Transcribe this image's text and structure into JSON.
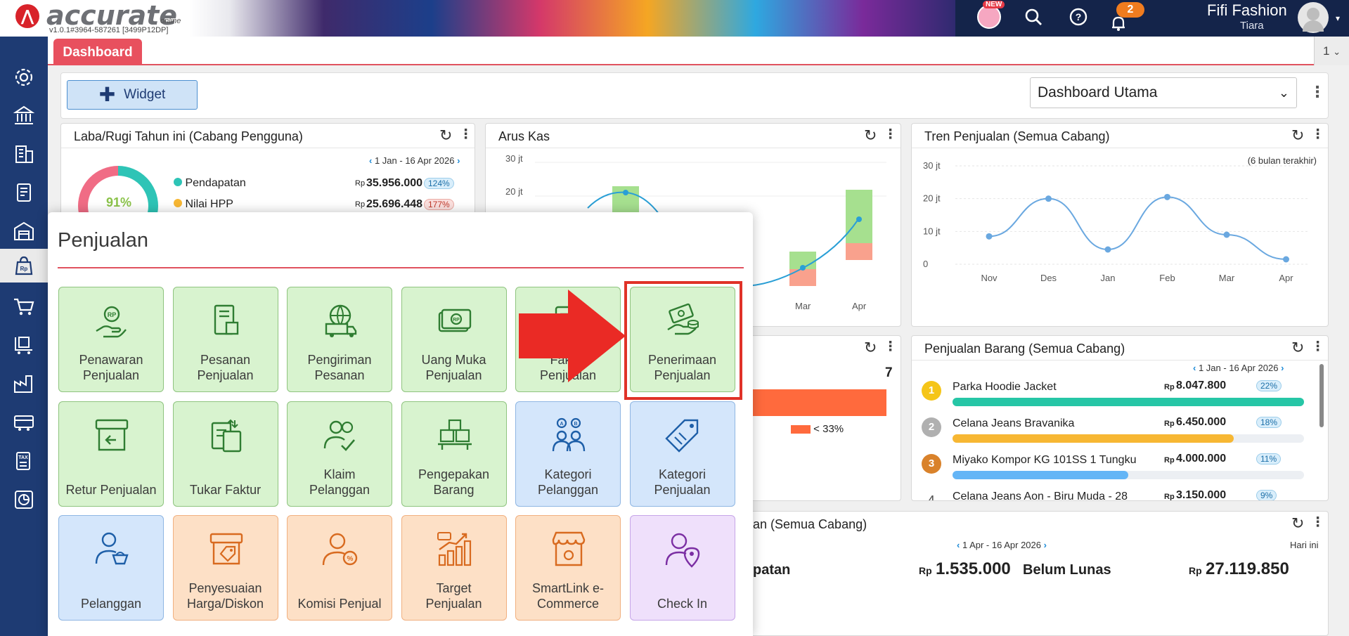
{
  "app": {
    "logo_text": "accurate",
    "logo_sub": "online",
    "version": "v1.0.1#3964-587261 [3499P12DP]",
    "new_badge": "NEW",
    "notification_count": "2",
    "company": "Fifi Fashion",
    "user": "Tiara"
  },
  "tabs": {
    "active": "Dashboard",
    "count": "1"
  },
  "toolbar": {
    "widget_label": "Widget",
    "dashboard_select": "Dashboard Utama"
  },
  "cards": {
    "labarugi": {
      "title": "Laba/Rugi Tahun ini (Cabang Pengguna)",
      "range": "1 Jan - 16 Apr 2026",
      "gauge_text": "91%",
      "rows": [
        {
          "label": "Pendapatan",
          "currency": "Rp",
          "value": "35.956.000",
          "pct": "124%"
        },
        {
          "label": "Nilai HPP",
          "currency": "Rp",
          "value": "25.696.448",
          "pct": "177%"
        }
      ]
    },
    "aruskas": {
      "title": "Arus Kas",
      "ticks": [
        "30 jt",
        "20 jt"
      ],
      "months": [
        "Mar",
        "Apr"
      ]
    },
    "tren": {
      "title": "Tren Penjualan (Semua Cabang)",
      "note": "(6 bulan terakhir)",
      "ticks": [
        "30 jt",
        "20 jt",
        "10 jt",
        "0"
      ],
      "months": [
        "Nov",
        "Des",
        "Jan",
        "Feb",
        "Mar",
        "Apr"
      ]
    },
    "hidden_mid": {
      "value": "7",
      "legend": "< 33%"
    },
    "penjualan_barang": {
      "title": "Penjualan Barang (Semua Cabang)",
      "range": "1 Jan - 16 Apr 2026",
      "items": [
        {
          "rank": "1",
          "name": "Parka Hoodie Jacket",
          "currency": "Rp",
          "value": "8.047.800",
          "pct": "22%",
          "fill": 1.0,
          "color": "#26c6a6"
        },
        {
          "rank": "2",
          "name": "Celana Jeans Bravanika",
          "currency": "Rp",
          "value": "6.450.000",
          "pct": "18%",
          "fill": 0.8,
          "color": "#f7b733"
        },
        {
          "rank": "3",
          "name": "Miyako Kompor KG 101SS 1 Tungku",
          "currency": "Rp",
          "value": "4.000.000",
          "pct": "11%",
          "fill": 0.5,
          "color": "#64b5f6"
        },
        {
          "rank": "4",
          "name": "Celana Jeans Aon - Biru Muda - 28",
          "currency": "Rp",
          "value": "3.150.000",
          "pct": "9%",
          "fill": 0.39,
          "color": "#ffa64d"
        }
      ]
    },
    "bottom": {
      "title_partial": "an (Semua Cabang)",
      "range": "1 Apr - 16 Apr 2026",
      "right_note": "Hari ini",
      "left_label_partial": "patan",
      "left_currency": "Rp",
      "left_value": "1.535.000",
      "right_label": "Belum Lunas",
      "right_currency": "Rp",
      "right_value": "27.119.850"
    }
  },
  "popup": {
    "title": "Penjualan",
    "tiles": [
      {
        "line1": "Penawaran",
        "line2": "Penjualan",
        "color": "green",
        "icon": "quotation-icon"
      },
      {
        "line1": "Pesanan",
        "line2": "Penjualan",
        "color": "green",
        "icon": "sales-order-icon"
      },
      {
        "line1": "Pengiriman",
        "line2": "Pesanan",
        "color": "green",
        "icon": "delivery-icon"
      },
      {
        "line1": "Uang Muka",
        "line2": "Penjualan",
        "color": "green",
        "icon": "down-payment-icon"
      },
      {
        "line1": "Faktur",
        "line2": "Penjualan",
        "color": "green",
        "icon": "invoice-icon"
      },
      {
        "line1": "Penerimaan",
        "line2": "Penjualan",
        "color": "green",
        "icon": "receipt-icon"
      },
      {
        "line1": "",
        "line2": "Retur Penjualan",
        "color": "green",
        "icon": "sales-return-icon"
      },
      {
        "line1": "",
        "line2": "Tukar Faktur",
        "color": "green",
        "icon": "invoice-exchange-icon"
      },
      {
        "line1": "Klaim",
        "line2": "Pelanggan",
        "color": "green",
        "icon": "customer-claim-icon"
      },
      {
        "line1": "Pengepakan",
        "line2": "Barang",
        "color": "green",
        "icon": "packing-icon"
      },
      {
        "line1": "Kategori",
        "line2": "Pelanggan",
        "color": "blue",
        "icon": "customer-category-icon"
      },
      {
        "line1": "Kategori",
        "line2": "Penjualan",
        "color": "blue",
        "icon": "sales-category-icon"
      },
      {
        "line1": "",
        "line2": "Pelanggan",
        "color": "blue",
        "icon": "customer-icon"
      },
      {
        "line1": "Penyesuaian",
        "line2": "Harga/Diskon",
        "color": "orange",
        "icon": "price-adjustment-icon"
      },
      {
        "line1": "",
        "line2": "Komisi Penjual",
        "color": "orange",
        "icon": "commission-icon"
      },
      {
        "line1": "Target",
        "line2": "Penjualan",
        "color": "orange",
        "icon": "sales-target-icon"
      },
      {
        "line1": "SmartLink e-",
        "line2": "Commerce",
        "color": "orange",
        "icon": "ecommerce-store-icon"
      },
      {
        "line1": "",
        "line2": "Check In",
        "color": "purple",
        "icon": "check-in-icon"
      }
    ]
  },
  "colors": {
    "accent_red": "#e8505e",
    "sidebar": "#1e3b73",
    "tile_green_icon": "#2f7d32",
    "tile_blue_icon": "#1e5fa8",
    "tile_orange_icon": "#d86a1f",
    "tile_purple_icon": "#7b2ea3",
    "highlight": "#e03228"
  }
}
